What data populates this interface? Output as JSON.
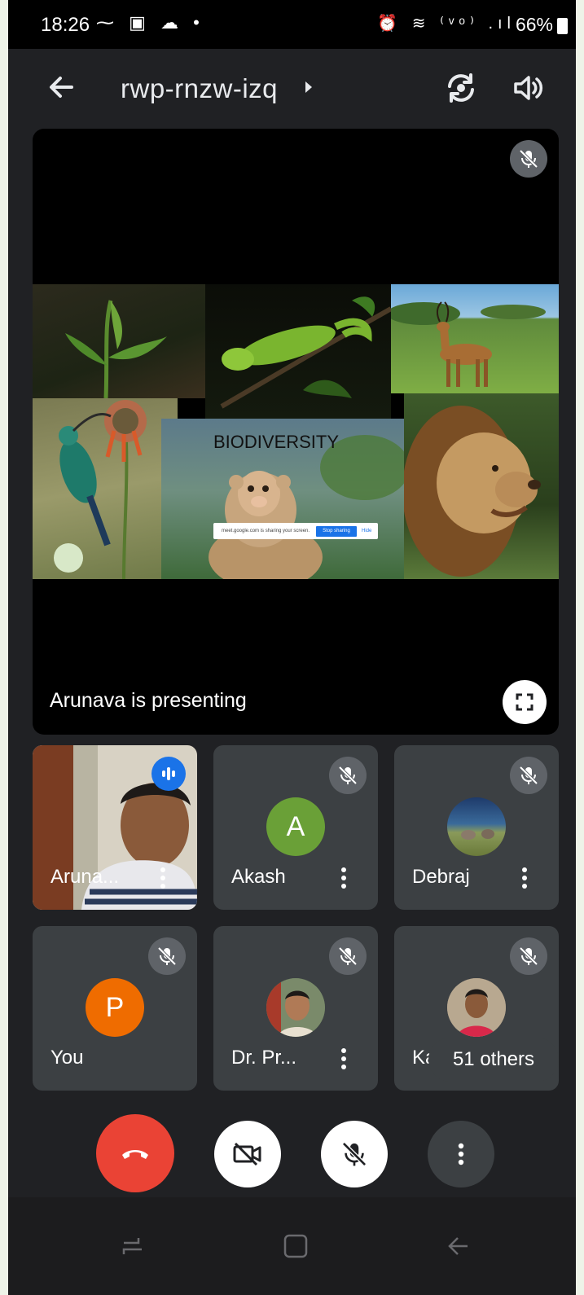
{
  "status_bar": {
    "time": "18:26",
    "left_icons": "⁓ ▣ ☁ •",
    "right_icons": "⏰ ≋ ⁽ᵛᵒ⁾ .ıl",
    "battery": "66%"
  },
  "top_bar": {
    "meeting_code": "rwp-rnzw-izq",
    "icons": [
      "back-arrow-icon",
      "switch-camera-icon",
      "speaker-icon"
    ]
  },
  "presentation": {
    "slide_title": "BIODIVERSITY",
    "share_notice": "meet.google.com is sharing your screen.",
    "stop_sharing_label": "Stop sharing",
    "hide_label": "Hide",
    "presenter_label": "Arunava is presenting"
  },
  "participants": [
    {
      "name": "Aruna...",
      "avatar_type": "video",
      "speaking": true
    },
    {
      "name": "Akash",
      "avatar_type": "letter",
      "letter": "A",
      "avatar_color": "#6aa037",
      "muted": true
    },
    {
      "name": "Debraj",
      "avatar_type": "photo",
      "muted": true
    },
    {
      "name": "You",
      "avatar_type": "letter",
      "letter": "P",
      "avatar_color": "#ef6c00",
      "muted": true
    },
    {
      "name": "Dr. Pr...",
      "avatar_type": "photo",
      "muted": true
    },
    {
      "name": "Ka",
      "avatar_type": "photo",
      "muted": true
    }
  ],
  "others_pill": "51 others",
  "controls": [
    "end-call-icon",
    "camera-off-icon",
    "mic-off-icon",
    "more-options-icon"
  ],
  "colors": {
    "background": "#202124",
    "tile": "#3c4043",
    "end_call": "#ea4335",
    "speaking_badge": "#1a73e8"
  }
}
